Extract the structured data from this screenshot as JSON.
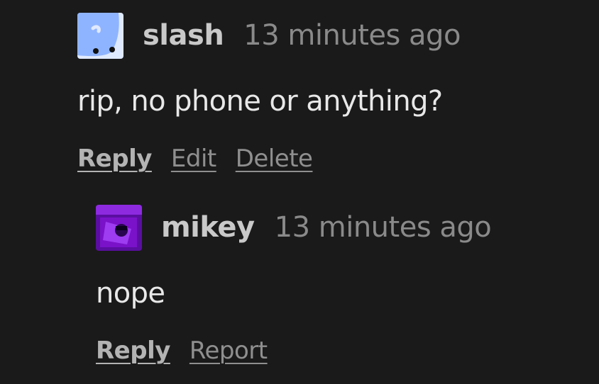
{
  "comments": [
    {
      "username": "slash",
      "timestamp": "13 minutes ago",
      "text": "rip, no phone or anything?",
      "actions": [
        "Reply",
        "Edit",
        "Delete"
      ]
    },
    {
      "username": "mikey",
      "timestamp": "13 minutes ago",
      "text": "nope",
      "actions": [
        "Reply",
        "Report"
      ]
    }
  ],
  "colors": {
    "background": "#1a1a1a",
    "username": "#c9c9c9",
    "timestamp": "#8a8a8a",
    "text": "#e8e8e8",
    "action": "#8f8f8f",
    "avatar_slash": "#8fb4ff",
    "avatar_mikey": "#7a12c9"
  }
}
